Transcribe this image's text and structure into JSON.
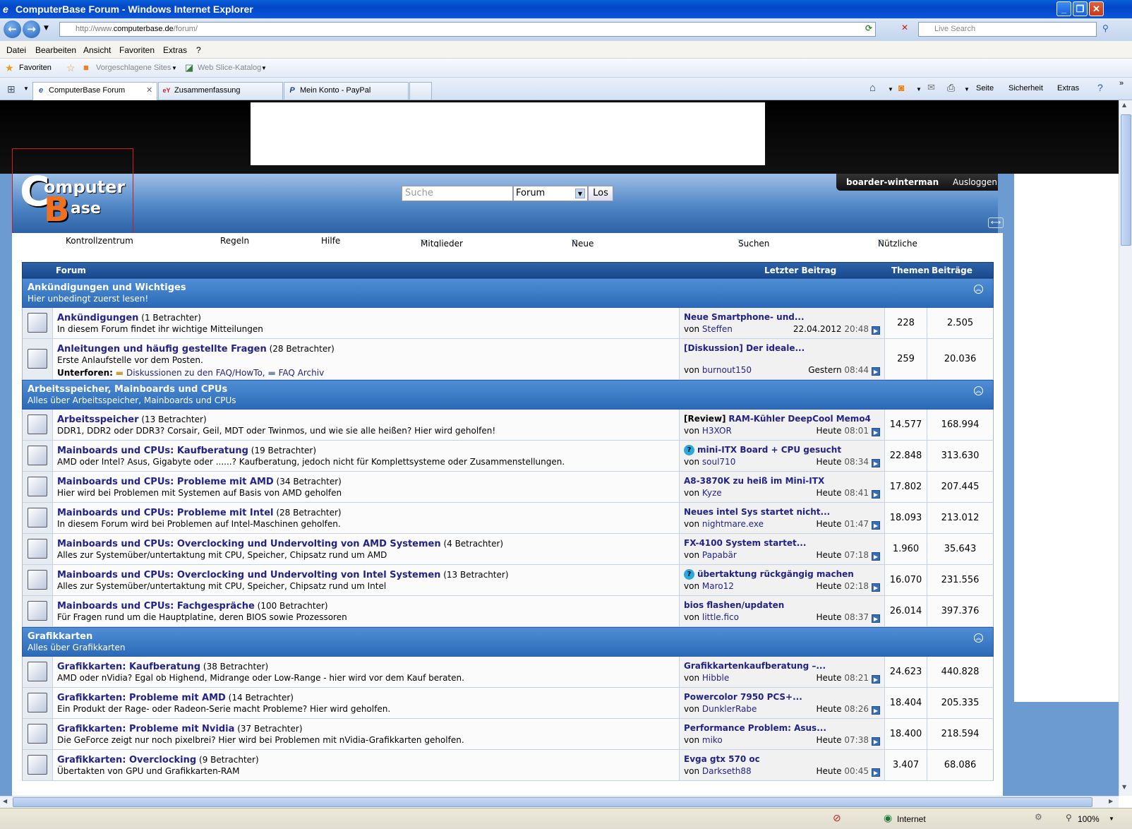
{
  "window": {
    "title": "ComputerBase Forum - Windows Internet Explorer"
  },
  "address": {
    "url_prefix": "http://www.",
    "url_host": "computerbase.de",
    "url_path": "/forum/",
    "search_placeholder": "Live Search"
  },
  "menu": [
    "Datei",
    "Bearbeiten",
    "Ansicht",
    "Favoriten",
    "Extras",
    "?"
  ],
  "favorites": {
    "label": "Favoriten",
    "suggested": "Vorgeschlagene Sites",
    "webslice": "Web Slice-Katalog"
  },
  "tabs": [
    {
      "label": "ComputerBase Forum",
      "icon": "e"
    },
    {
      "label": "Zusammenfassung",
      "icon": "eY"
    },
    {
      "label": "Mein Konto - PayPal",
      "icon": "P"
    }
  ],
  "tools": {
    "seite": "Seite",
    "sicherheit": "Sicherheit",
    "extras": "Extras"
  },
  "site": {
    "search_placeholder": "Suche",
    "search_scope": "Forum",
    "search_button": "Los",
    "username": "boarder-winterman",
    "logout": "Ausloggen",
    "nav": [
      "Kontrollzentrum",
      "Regeln",
      "Hilfe",
      "Mitglieder",
      "Neue Beiträge",
      "Suchen",
      "Nützliche Links"
    ]
  },
  "table": {
    "headers": {
      "forum": "Forum",
      "last": "Letzter Beitrag",
      "threads": "Themen",
      "posts": "Beiträge"
    },
    "categories": [
      {
        "title": "Ankündigungen und Wichtiges",
        "desc": "Hier unbedingt zuerst lesen!",
        "forums": [
          {
            "name": "Ankündigungen",
            "viewers": "(1 Betrachter)",
            "desc": "In diesem Forum findet ihr wichtige Mitteilungen",
            "last_title": "Neue Smartphone- und...",
            "last_by": "Steffen",
            "last_date": "22.04.2012",
            "last_time": "20:48",
            "threads": "228",
            "posts": "2.505"
          },
          {
            "name": "Anleitungen und häufig gestellte Fragen",
            "viewers": "(28 Betrachter)",
            "desc": "Erste Anlaufstelle vor dem Posten.",
            "sub_label": "Unterforen:",
            "sub1": "Diskussionen zu den FAQ/HowTo,",
            "sub2": "FAQ Archiv",
            "last_title": "[Diskussion] Der ideale...",
            "last_by": "burnout150",
            "last_date": "Gestern",
            "last_time": "08:44",
            "threads": "259",
            "posts": "20.036"
          }
        ]
      },
      {
        "title": "Arbeitsspeicher, Mainboards und CPUs",
        "desc": "Alles über Arbeitsspeicher, Mainboards und CPUs",
        "forums": [
          {
            "name": "Arbeitsspeicher",
            "viewers": "(13 Betrachter)",
            "desc": "DDR1, DDR2 oder DDR3? Corsair, Geil, MDT oder Twinmos, und wie sie alle heißen? Hier wird geholfen!",
            "last_prefix": "[Review]",
            "last_title": "RAM-Kühler DeepCool Memo4",
            "last_by": "H3XOR",
            "last_date": "Heute",
            "last_time": "08:01",
            "threads": "14.577",
            "posts": "168.994"
          },
          {
            "name": "Mainboards und CPUs: Kaufberatung",
            "viewers": "(19 Betrachter)",
            "desc": "AMD oder Intel? Asus, Gigabyte oder ......? Kaufberatung, jedoch nicht für Komplettsysteme oder Zusammenstellungen.",
            "question": "?",
            "last_title": "mini-ITX Board + CPU gesucht",
            "last_by": "soul710",
            "last_date": "Heute",
            "last_time": "08:34",
            "threads": "22.848",
            "posts": "313.630"
          },
          {
            "name": "Mainboards und CPUs: Probleme mit AMD",
            "viewers": "(34 Betrachter)",
            "desc": "Hier wird bei Problemen mit Systemen auf Basis von AMD geholfen",
            "last_title": "A8-3870K zu heiß im Mini-ITX",
            "last_by": "Kyze",
            "last_date": "Heute",
            "last_time": "08:41",
            "threads": "17.802",
            "posts": "207.445"
          },
          {
            "name": "Mainboards und CPUs: Probleme mit Intel",
            "viewers": "(28 Betrachter)",
            "desc": "In diesem Forum wird bei Problemen auf Intel-Maschinen geholfen.",
            "last_title": "Neues intel Sys startet nicht...",
            "last_by": "nightmare.exe",
            "last_date": "Heute",
            "last_time": "01:47",
            "threads": "18.093",
            "posts": "213.012"
          },
          {
            "name": "Mainboards und CPUs: Overclocking und Undervolting von AMD Systemen",
            "viewers": "(4 Betrachter)",
            "desc": "Alles zur Systemüber/untertaktung mit CPU, Speicher, Chipsatz rund um AMD",
            "last_title": "FX-4100 System startet...",
            "last_by": "Papabär",
            "last_date": "Heute",
            "last_time": "07:18",
            "threads": "1.960",
            "posts": "35.643"
          },
          {
            "name": "Mainboards und CPUs: Overclocking und Undervolting von Intel Systemen",
            "viewers": "(13 Betrachter)",
            "desc": "Alles zur Systemüber/untertaktung mit CPU, Speicher, Chipsatz rund um Intel",
            "question": "?",
            "last_title": "übertaktung rückgängig machen",
            "last_by": "Maro12",
            "last_date": "Heute",
            "last_time": "02:18",
            "threads": "16.070",
            "posts": "231.556"
          },
          {
            "name": "Mainboards und CPUs: Fachgespräche",
            "viewers": "(100 Betrachter)",
            "desc": "Für Fragen rund um die Hauptplatine, deren BIOS sowie Prozessoren",
            "last_title": "bios flashen/updaten",
            "last_by": "little.fico",
            "last_date": "Heute",
            "last_time": "08:37",
            "threads": "26.014",
            "posts": "397.376"
          }
        ]
      },
      {
        "title": "Grafikkarten",
        "desc": "Alles über Grafikkarten",
        "forums": [
          {
            "name": "Grafikkarten: Kaufberatung",
            "viewers": "(38 Betrachter)",
            "desc": "AMD oder nVidia? Egal ob Highend, Midrange oder Low-Range - hier wird vor dem Kauf beraten.",
            "last_title": "Grafikkartenkaufberatung –...",
            "last_by": "Hibble",
            "last_date": "Heute",
            "last_time": "08:21",
            "threads": "24.623",
            "posts": "440.828"
          },
          {
            "name": "Grafikkarten: Probleme mit AMD",
            "viewers": "(14 Betrachter)",
            "desc": "Ein Produkt der Rage- oder Radeon-Serie macht Probleme? Hier wird geholfen.",
            "last_title": "Powercolor 7950 PCS+...",
            "last_by": "DunklerRabe",
            "last_date": "Heute",
            "last_time": "08:26",
            "threads": "18.404",
            "posts": "205.335"
          },
          {
            "name": "Grafikkarten: Probleme mit Nvidia",
            "viewers": "(37 Betrachter)",
            "desc": "Die GeForce zeigt nur noch pixelbrei? Hier wird bei Problemen mit nVidia-Grafikkarten geholfen.",
            "last_title": "Performance Problem: Asus...",
            "last_by": "miko",
            "last_date": "Heute",
            "last_time": "07:38",
            "threads": "18.400",
            "posts": "218.594"
          },
          {
            "name": "Grafikkarten: Overclocking",
            "viewers": "(9 Betrachter)",
            "desc": "Übertakten von GPU und Grafikkarten-RAM",
            "last_title": "Evga gtx 570 oc",
            "last_by": "Darkseth88",
            "last_date": "Heute",
            "last_time": "00:45",
            "threads": "3.407",
            "posts": "68.086"
          }
        ]
      }
    ],
    "von": "von"
  },
  "status": {
    "zone": "Internet",
    "zoom": "100%"
  }
}
